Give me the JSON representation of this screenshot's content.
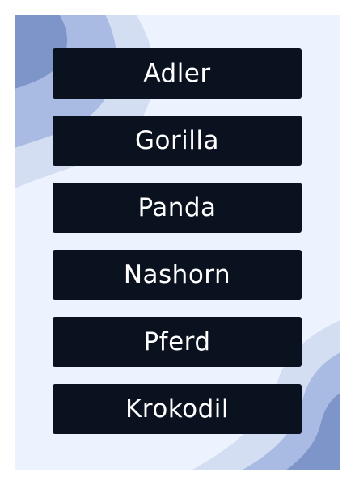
{
  "colors": {
    "page_background": "#edf3fe",
    "card_background": "#0a1220",
    "card_text": "#ffffff",
    "wave_dark": "#7e95c9",
    "wave_mid": "#a9bbe2",
    "wave_light": "#d4def3"
  },
  "words": [
    {
      "label": "Adler"
    },
    {
      "label": "Gorilla"
    },
    {
      "label": "Panda"
    },
    {
      "label": "Nashorn"
    },
    {
      "label": "Pferd"
    },
    {
      "label": "Krokodil"
    }
  ]
}
